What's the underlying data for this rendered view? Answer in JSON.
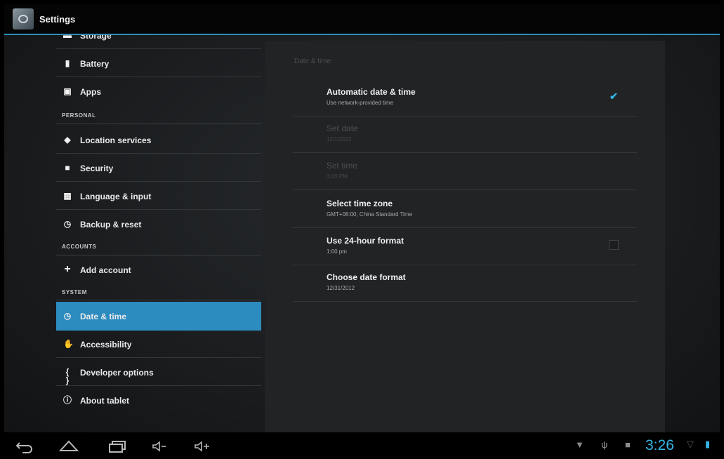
{
  "app": {
    "title": "Settings",
    "icon": "settings-icon"
  },
  "sidebar": {
    "items_top": [
      {
        "label": "Storage",
        "icon": "storage-icon"
      },
      {
        "label": "Battery",
        "icon": "battery-icon"
      },
      {
        "label": "Apps",
        "icon": "apps-icon"
      }
    ],
    "personal_header": "PERSONAL",
    "personal": [
      {
        "label": "Location services",
        "icon": "location-icon"
      },
      {
        "label": "Security",
        "icon": "lock-icon"
      },
      {
        "label": "Language & input",
        "icon": "language-icon"
      },
      {
        "label": "Backup & reset",
        "icon": "backup-icon"
      }
    ],
    "accounts_header": "ACCOUNTS",
    "accounts": [
      {
        "label": "Add account",
        "icon": "plus-icon"
      }
    ],
    "system_header": "SYSTEM",
    "system": [
      {
        "label": "Date & time",
        "icon": "clock-icon",
        "selected": true
      },
      {
        "label": "Accessibility",
        "icon": "hand-icon"
      },
      {
        "label": "Developer options",
        "icon": "braces-icon"
      },
      {
        "label": "About tablet",
        "icon": "info-icon"
      }
    ]
  },
  "detail": {
    "header": "Date & time",
    "prefs": [
      {
        "title": "Automatic date & time",
        "summary": "Use network-provided time",
        "checkbox": "checked"
      },
      {
        "title": "Set date",
        "summary": "12/1/2012",
        "disabled": true
      },
      {
        "title": "Set time",
        "summary": "3:26 PM",
        "disabled": true
      },
      {
        "title": "Select time zone",
        "summary": "GMT+08:00, China Standard Time"
      },
      {
        "title": "Use 24-hour format",
        "summary": "1:00 pm",
        "checkbox": "unchecked"
      },
      {
        "title": "Choose date format",
        "summary": "12/31/2012"
      }
    ]
  },
  "navbar": {
    "buttons": [
      "back-icon",
      "home-icon",
      "recent-apps-icon",
      "volume-down-icon",
      "volume-up-icon"
    ],
    "status_icons": [
      "wifi-icon",
      "usb-icon",
      "notification-icon"
    ],
    "clock": "3:26",
    "accent": "#33b5e5"
  }
}
